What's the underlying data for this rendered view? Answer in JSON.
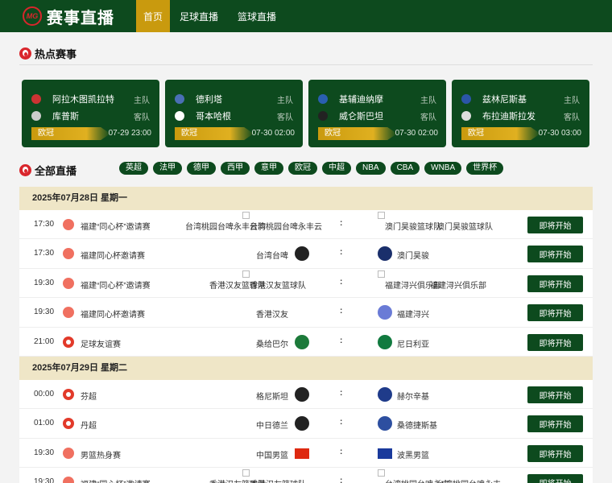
{
  "header": {
    "logo_text": "MG",
    "site_title": "赛事直播",
    "nav": [
      "首页",
      "足球直播",
      "篮球直播"
    ]
  },
  "hot": {
    "title": "热点赛事",
    "cards": [
      {
        "home": "阿拉木图凯拉特",
        "home_role": "主队",
        "away": "库普斯",
        "away_role": "客队",
        "league": "欧冠",
        "time": "07-29 23:00"
      },
      {
        "home": "德利塔",
        "home_role": "主队",
        "away": "哥本哈根",
        "away_role": "客队",
        "league": "欧冠",
        "time": "07-30 02:00"
      },
      {
        "home": "基辅迪纳摩",
        "home_role": "主队",
        "away": "威仑斯巴坦",
        "away_role": "客队",
        "league": "欧冠",
        "time": "07-30 02:00"
      },
      {
        "home": "兹林尼斯基",
        "home_role": "主队",
        "away": "布拉迪斯拉发",
        "away_role": "客队",
        "league": "欧冠",
        "time": "07-30 03:00"
      }
    ]
  },
  "all": {
    "title": "全部直播",
    "chips": [
      "英超",
      "法甲",
      "德甲",
      "西甲",
      "意甲",
      "欧冠",
      "中超",
      "NBA",
      "CBA",
      "WNBA",
      "世界杯"
    ]
  },
  "days": [
    {
      "date": "2025年07月28日 星期一",
      "matches": [
        {
          "time": "17:30",
          "sport": "basketball",
          "league": "福建“同心杯”邀请赛",
          "home": "台湾桃园台啤永丰云豹",
          "home_logo_text": "台湾桃园台啤永丰云",
          "away": "澳门昊骏篮球队",
          "away_logo_text": "澳门昊骏篮球队",
          "status": "即将开始"
        },
        {
          "time": "17:30",
          "sport": "basketball",
          "league": "福建同心杯邀请赛",
          "home": "台湾台啤",
          "home_logo_text": "",
          "away": "澳门昊骏",
          "away_logo_text": "",
          "status": "即将开始"
        },
        {
          "time": "19:30",
          "sport": "basketball",
          "league": "福建“同心杯”邀请赛",
          "home": "香港汉友篮球队",
          "home_logo_text": "香港汉友篮球队",
          "away": "",
          "away_logo_text": "福建浔兴俱乐部",
          "away_name2": "福建浔兴俱乐部",
          "status": "即将开始"
        },
        {
          "time": "19:30",
          "sport": "basketball",
          "league": "福建同心杯邀请赛",
          "home": "香港汉友",
          "home_logo_text": "",
          "away": "福建浔兴",
          "away_logo_text": "",
          "status": "即将开始"
        },
        {
          "time": "21:00",
          "sport": "soccer",
          "league": "足球友谊赛",
          "home": "桑给巴尔",
          "home_logo_text": "",
          "away": "尼日利亚",
          "away_logo_text": "",
          "status": "即将开始"
        }
      ]
    },
    {
      "date": "2025年07月29日 星期二",
      "matches": [
        {
          "time": "00:00",
          "sport": "soccer",
          "league": "芬超",
          "home": "格尼斯坦",
          "home_logo_text": "",
          "away": "赫尔辛基",
          "away_logo_text": "",
          "status": "即将开始"
        },
        {
          "time": "01:00",
          "sport": "soccer",
          "league": "丹超",
          "home": "中日德兰",
          "home_logo_text": "",
          "away": "桑德捷斯基",
          "away_logo_text": "",
          "status": "即将开始"
        },
        {
          "time": "19:30",
          "sport": "basketball",
          "league": "男篮热身赛",
          "home": "中国男篮",
          "home_logo_text": "",
          "away": "波黑男篮",
          "away_logo_text": "",
          "status": "即将开始"
        },
        {
          "time": "19:30",
          "sport": "basketball",
          "league": "福建“同心杯”邀请赛",
          "home": "香港汉友篮球队",
          "home_logo_text": "香港汉友篮球队",
          "away": "台湾桃园台啤永丰",
          "away_logo_text": "台湾桃园台啤永丰",
          "status": "即将开始"
        }
      ]
    }
  ],
  "vs_symbol": ":",
  "colors": {
    "primary": "#0d4a1e",
    "accent": "#c99a0e",
    "date_bg": "#efe6c7",
    "red": "#d9262c"
  }
}
